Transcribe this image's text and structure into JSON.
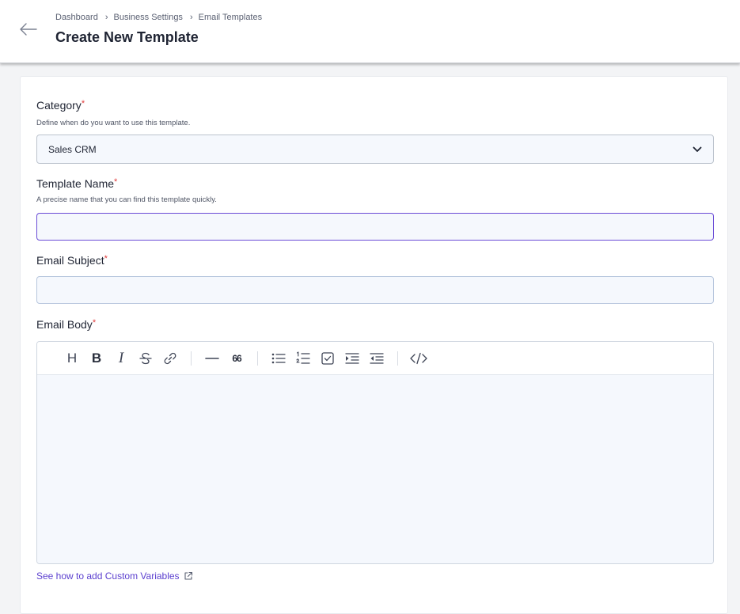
{
  "header": {
    "breadcrumb": [
      "Dashboard",
      "Business Settings",
      "Email Templates"
    ],
    "breadcrumb_separator": "›",
    "title": "Create New Template"
  },
  "form": {
    "required_marker": "*",
    "category": {
      "label": "Category",
      "help": "Define when do you want to use this template.",
      "selected": "Sales CRM"
    },
    "template_name": {
      "label": "Template Name",
      "help": "A precise name that you can find this template quickly.",
      "value": ""
    },
    "email_subject": {
      "label": "Email Subject",
      "value": ""
    },
    "email_body": {
      "label": "Email Body",
      "toolbar": {
        "heading": "H",
        "bold": "B",
        "italic": "I",
        "quote": "66"
      }
    },
    "custom_variables_link": "See how to add Custom Variables"
  },
  "colors": {
    "accent": "#5b3fcf",
    "required": "#e03a3a",
    "active_border": "#6a4bd6"
  }
}
